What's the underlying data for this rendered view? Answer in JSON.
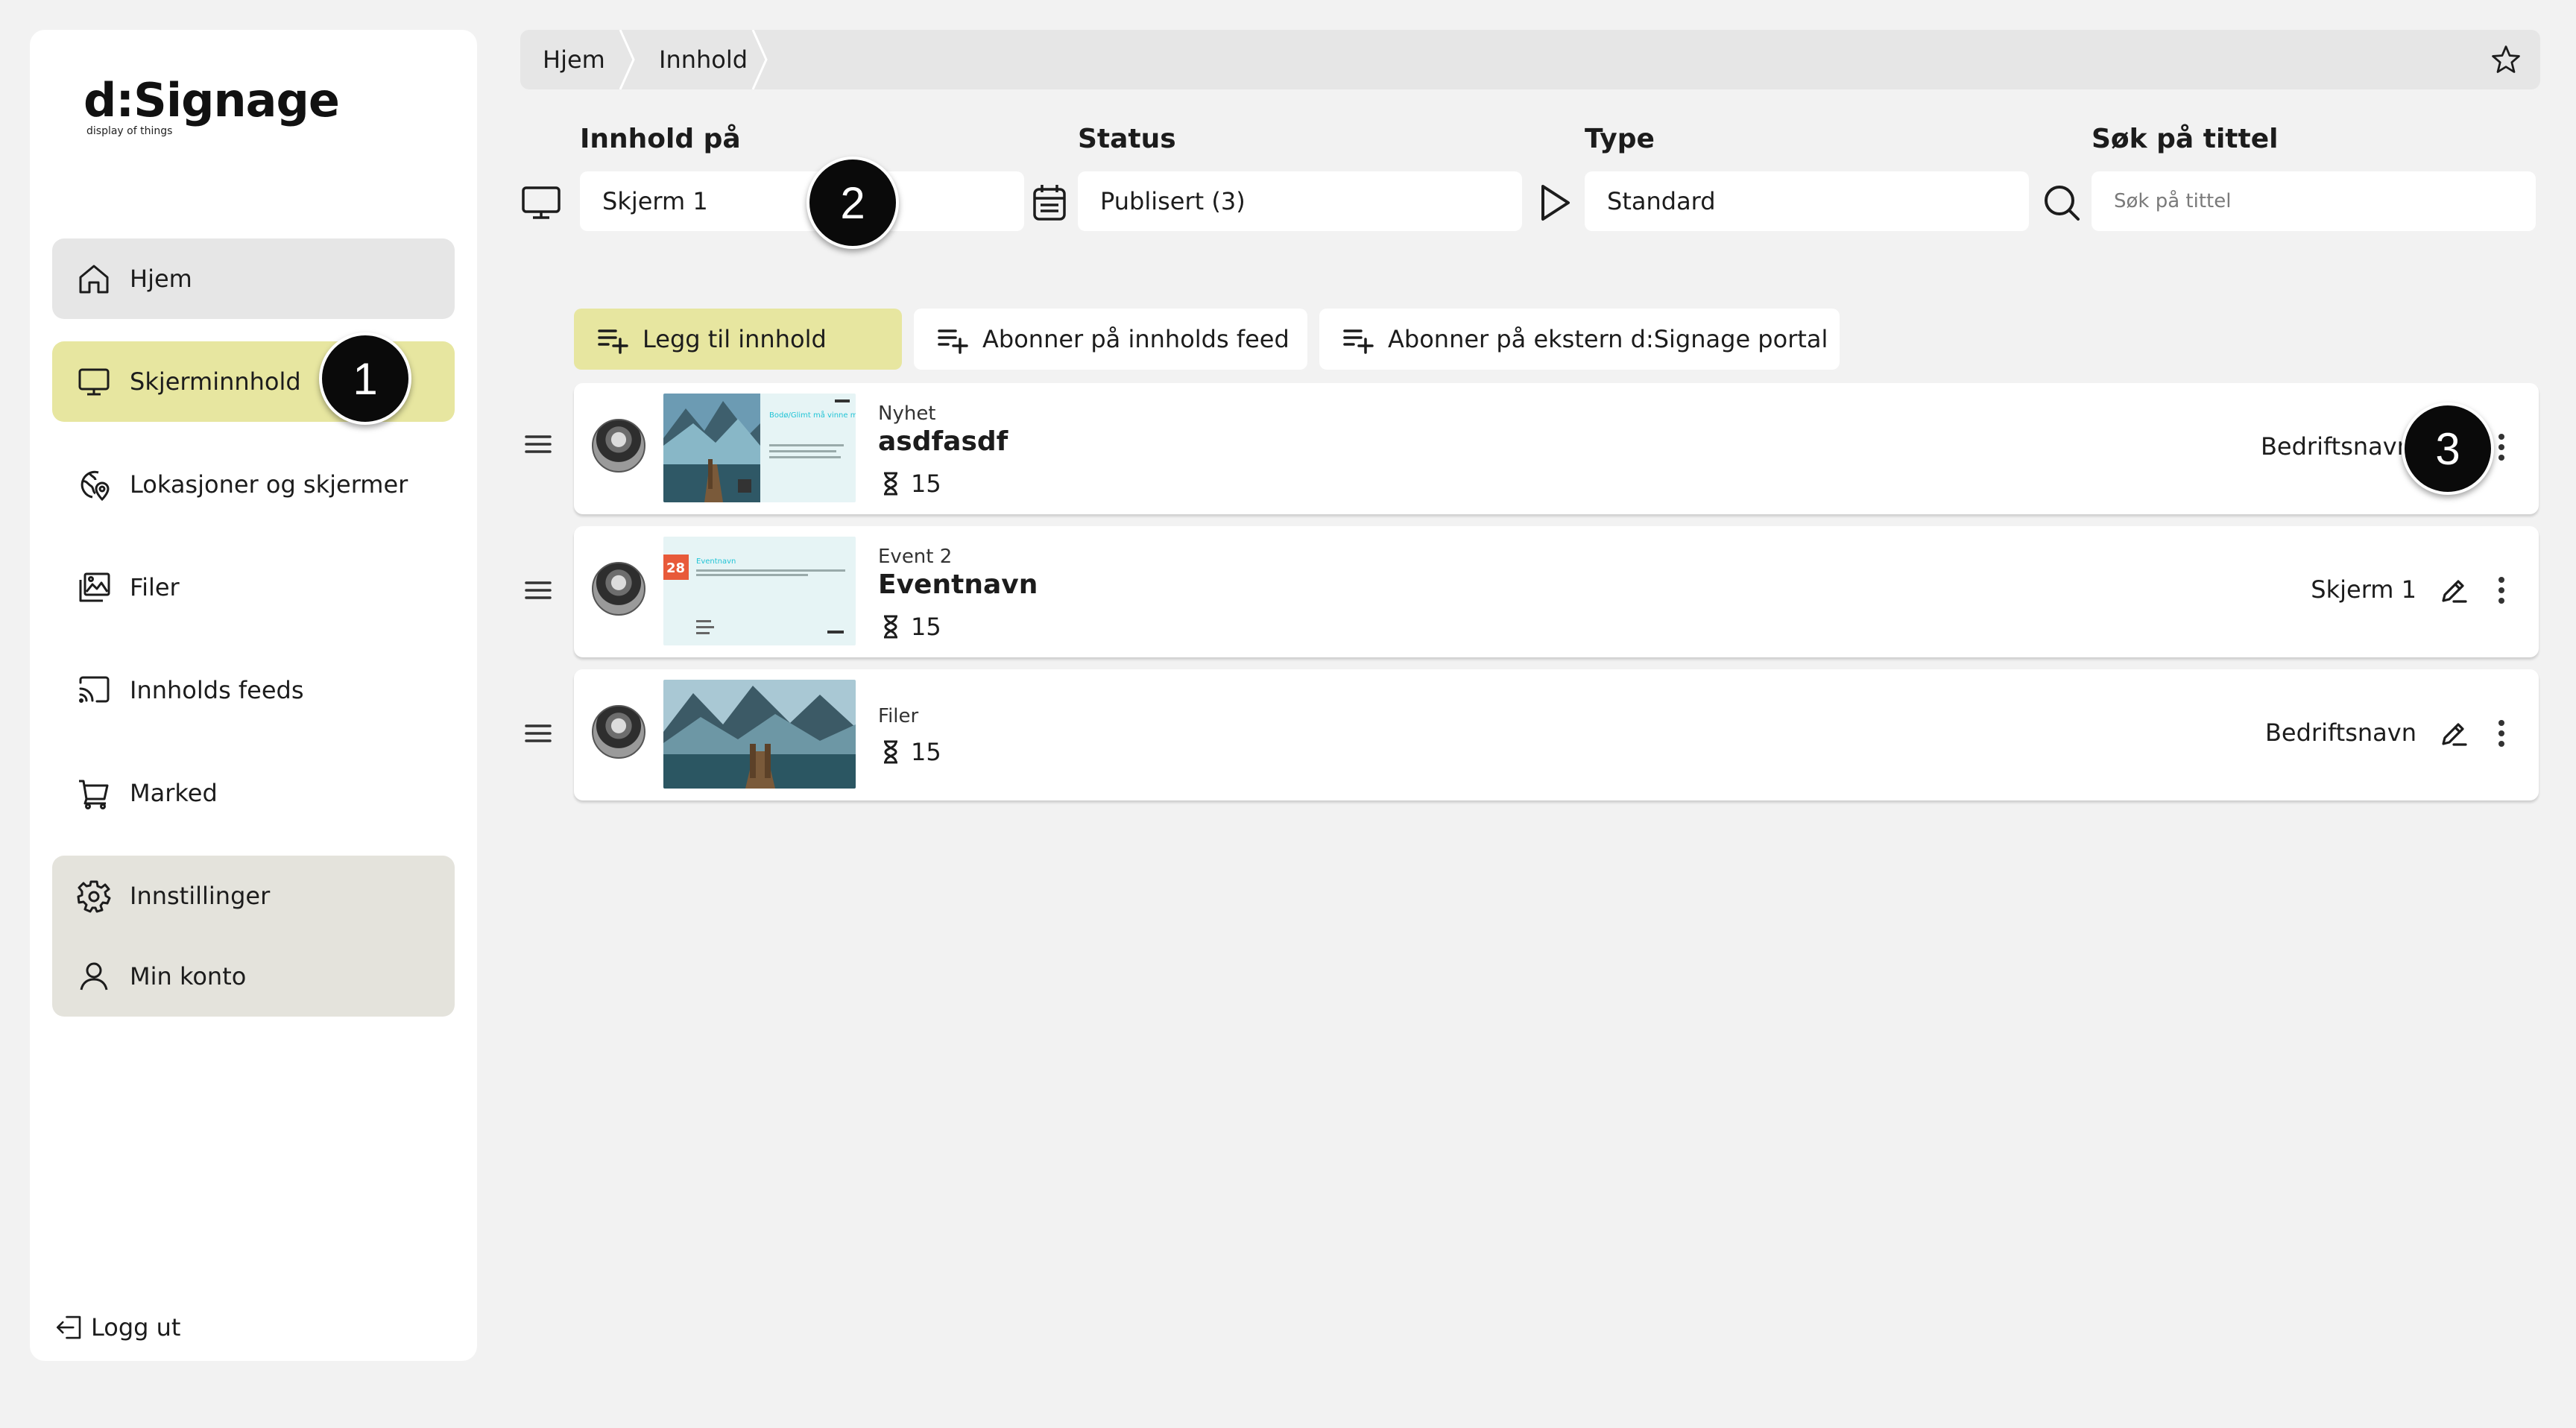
{
  "app": {
    "logo_main": "d:Signage",
    "logo_sub": "display of things"
  },
  "sidebar": {
    "items": [
      {
        "label": "Hjem",
        "icon": "home-icon"
      },
      {
        "label": "Skjerminnhold",
        "icon": "monitor-icon"
      },
      {
        "label": "Lokasjoner og skjermer",
        "icon": "location-globe-icon"
      },
      {
        "label": "Filer",
        "icon": "image-gallery-icon"
      },
      {
        "label": "Innholds feeds",
        "icon": "cast-icon"
      },
      {
        "label": "Marked",
        "icon": "cart-icon"
      }
    ],
    "settings": [
      {
        "label": "Innstillinger",
        "icon": "gear-icon"
      },
      {
        "label": "Min konto",
        "icon": "user-icon"
      }
    ],
    "logout_label": "Logg ut"
  },
  "breadcrumb": [
    "Hjem",
    "Innhold"
  ],
  "filters": {
    "screen": {
      "label": "Innhold på",
      "value": "Skjerm 1"
    },
    "status": {
      "label": "Status",
      "value": "Publisert (3)"
    },
    "type": {
      "label": "Type",
      "value": "Standard"
    },
    "search": {
      "label": "Søk på tittel",
      "placeholder": "Søk på tittel"
    }
  },
  "actions": {
    "add": "Legg til innhold",
    "subscribe_feed": "Abonner på innholds feed",
    "subscribe_portal": "Abonner på ekstern d:Signage portal"
  },
  "content_rows": [
    {
      "type": "Nyhet",
      "title": "asdfasdf",
      "duration": "15",
      "target": "Bedriftsnavn"
    },
    {
      "type": "Event 2",
      "title": "Eventnavn",
      "duration": "15",
      "target": "Skjerm 1"
    },
    {
      "type": "Filer",
      "title": "",
      "duration": "15",
      "target": "Bedriftsnavn"
    }
  ],
  "thumbs": {
    "news_heading": "Bodø/Glimt må vinne mot Juventus!",
    "event_date": "28",
    "event_name": "Eventnavn"
  },
  "callouts": [
    "1",
    "2",
    "3"
  ],
  "colors": {
    "accent": "#e7e6a0",
    "background": "#f2f2f2",
    "settings_box": "#e4e3dc"
  }
}
